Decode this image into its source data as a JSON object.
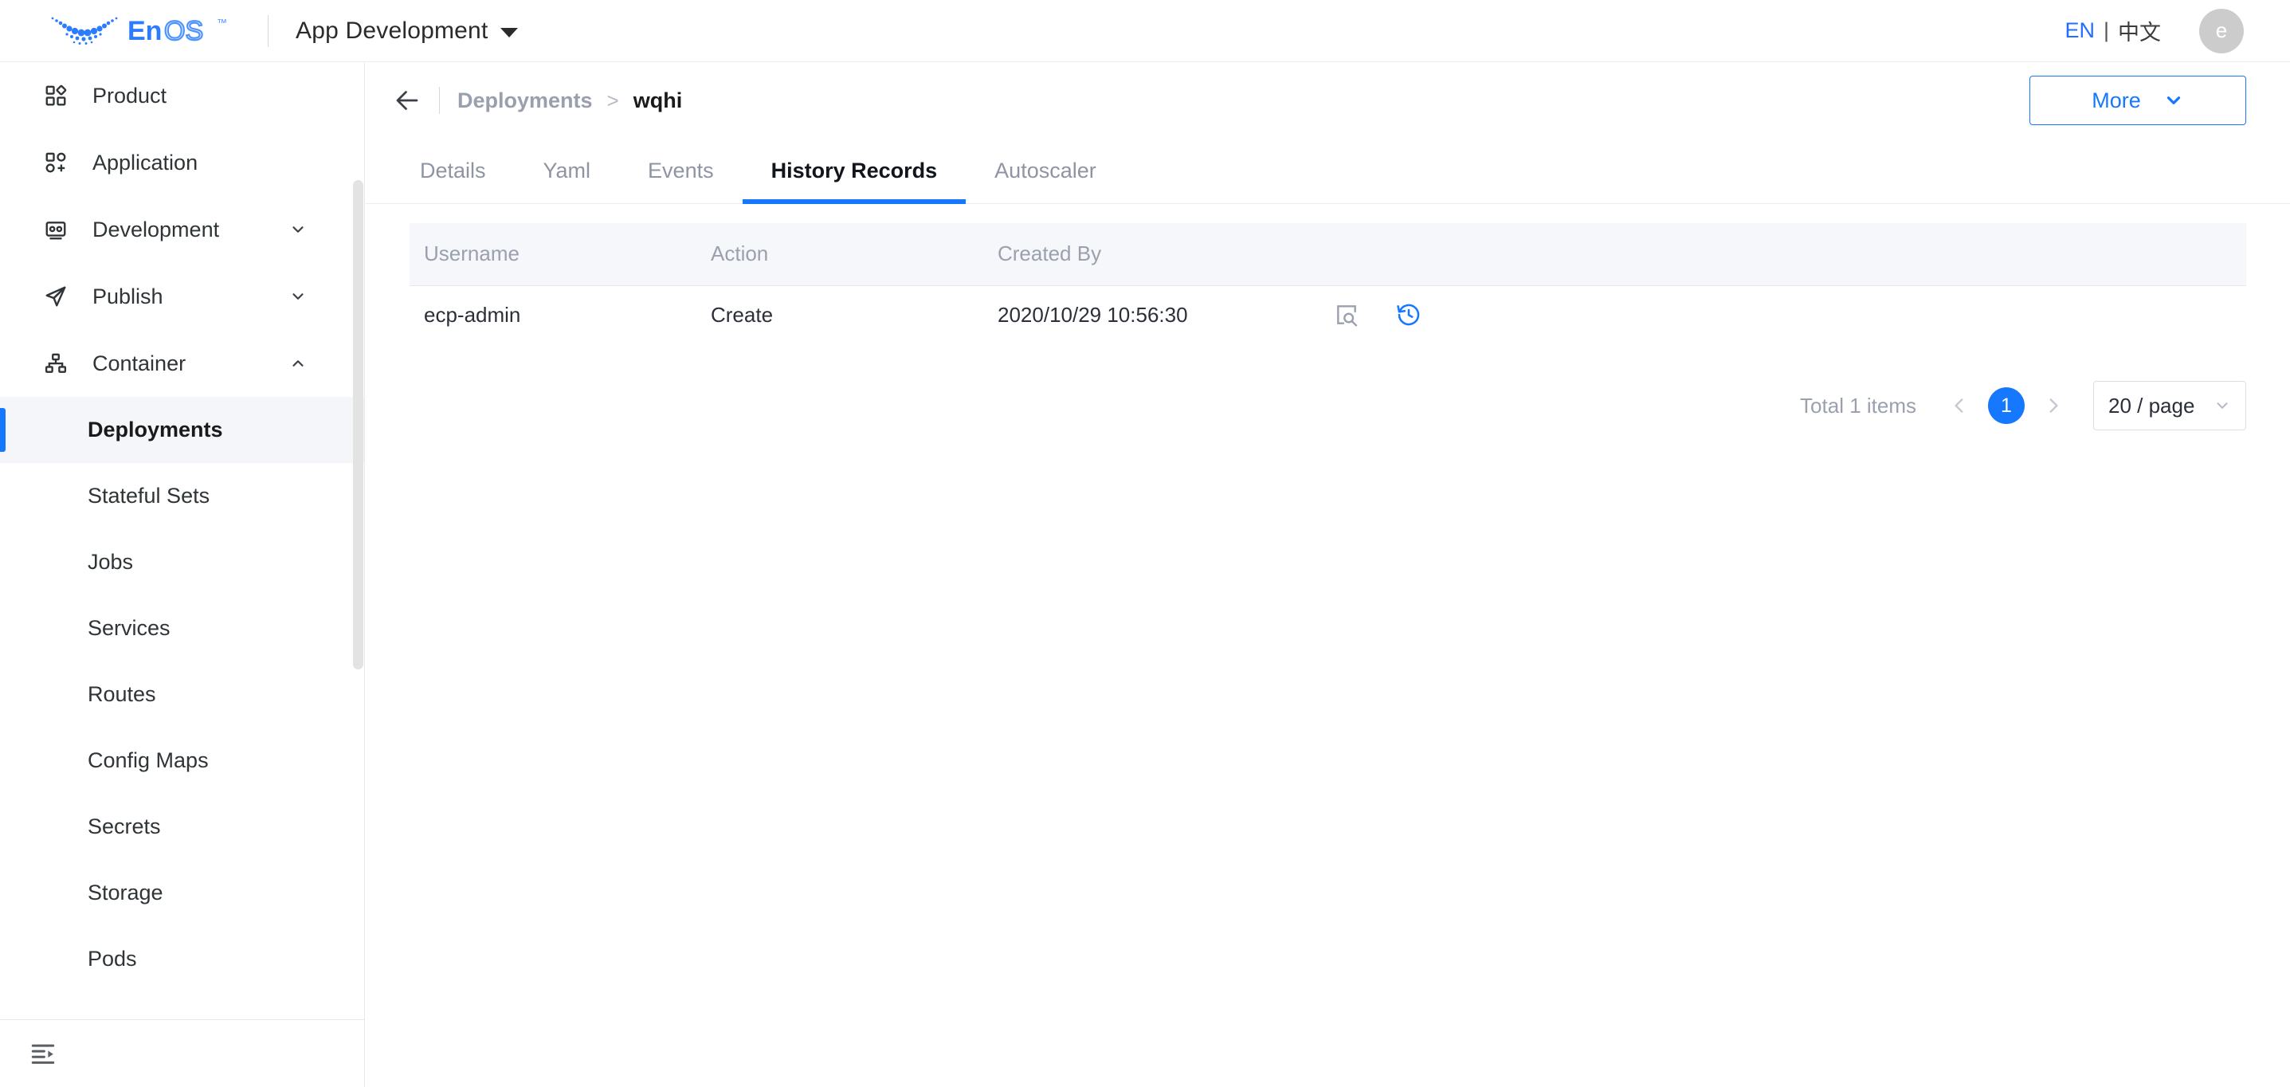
{
  "header": {
    "logo_text_primary": "En",
    "logo_text_secondary": "OS",
    "logo_tm": "™",
    "app_switcher_label": "App Development",
    "lang_en": "EN",
    "lang_separator": "|",
    "lang_zh": "中文",
    "avatar_initial": "e"
  },
  "sidebar": {
    "items": [
      {
        "label": "Product",
        "icon": "grid-diamond-icon",
        "expandable": false,
        "chevron": ""
      },
      {
        "label": "Application",
        "icon": "grid-plus-icon",
        "expandable": false,
        "chevron": ""
      },
      {
        "label": "Development",
        "icon": "robot-icon",
        "expandable": true,
        "chevron": "chevron-down-icon"
      },
      {
        "label": "Publish",
        "icon": "paper-plane-icon",
        "expandable": true,
        "chevron": "chevron-down-icon"
      },
      {
        "label": "Container",
        "icon": "sitemap-icon",
        "expandable": true,
        "chevron": "chevron-up-icon"
      }
    ],
    "sub_items": [
      {
        "label": "Deployments",
        "active": true
      },
      {
        "label": "Stateful Sets",
        "active": false
      },
      {
        "label": "Jobs",
        "active": false
      },
      {
        "label": "Services",
        "active": false
      },
      {
        "label": "Routes",
        "active": false
      },
      {
        "label": "Config Maps",
        "active": false
      },
      {
        "label": "Secrets",
        "active": false
      },
      {
        "label": "Storage",
        "active": false
      },
      {
        "label": "Pods",
        "active": false
      }
    ],
    "collapse_icon": "menu-fold-icon"
  },
  "page": {
    "back_icon": "arrow-left-icon",
    "breadcrumb_parent": "Deployments",
    "breadcrumb_separator": ">",
    "breadcrumb_current": "wqhi",
    "more_button_label": "More",
    "more_button_icon": "chevron-down-icon"
  },
  "tabs": [
    {
      "label": "Details",
      "active": false
    },
    {
      "label": "Yaml",
      "active": false
    },
    {
      "label": "Events",
      "active": false
    },
    {
      "label": "History Records",
      "active": true
    },
    {
      "label": "Autoscaler",
      "active": false
    }
  ],
  "table": {
    "columns": [
      "Username",
      "Action",
      "Created By",
      ""
    ],
    "rows": [
      {
        "username": "ecp-admin",
        "action": "Create",
        "created_by": "2020/10/29 10:56:30",
        "ops": [
          "view-detail-icon",
          "rollback-icon"
        ]
      }
    ]
  },
  "pagination": {
    "total_label": "Total 1 items",
    "prev_icon": "chevron-left-icon",
    "current_page": "1",
    "next_icon": "chevron-right-icon",
    "page_size_label": "20 / page",
    "page_size_caret": "chevron-down-icon"
  },
  "colors": {
    "accent": "#1677ff",
    "logo_blue": "#2b7cff",
    "active_bg": "#f5f6fa",
    "table_header_bg": "#f6f7fb",
    "muted_text": "#9aa0ae",
    "avatar_bg": "#cccccc"
  }
}
